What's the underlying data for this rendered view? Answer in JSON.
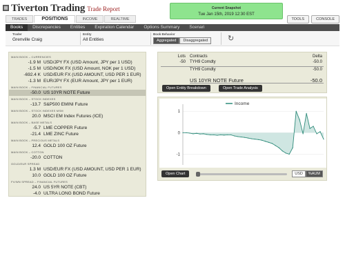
{
  "header": {
    "brand": "Tiverton Trading",
    "subtitle": "Trade Report",
    "snapshot_label": "Current Snapshot",
    "snapshot_time": "Tue Jan 15th, 2019 12:30 EST"
  },
  "top_tabs": [
    "TRADES",
    "POSITIONS",
    "INCOME",
    "REALTIME"
  ],
  "active_top_tab": "POSITIONS",
  "tools": [
    "TOOLS",
    "CONSOLE"
  ],
  "sub_tabs": [
    "Books",
    "Discrepancies",
    "Entities",
    "Expiration Calendar",
    "Options Summary",
    "Scenari"
  ],
  "active_sub_tab": "Books",
  "filters": {
    "trader_label": "Trader",
    "trader_value": "Grenville Craig",
    "entity_label": "Entity",
    "entity_value": "All Entities",
    "behavior_label": "Book Behavior",
    "aggregated": "Aggregated",
    "disaggregated": "Disaggregated",
    "active_behavior": "Aggregated",
    "refresh_icon": "refresh-icon"
  },
  "books": [
    {
      "group": "MAIN BOOK – CURRENCIES",
      "rows": [
        {
          "value": "-1.9 M",
          "name": "USD/JPY FX (USD Amount, JPY per 1 USD)"
        },
        {
          "value": "-1.5 M",
          "name": "USD/NOK FX (USD Amount, NOK per 1 USD)"
        },
        {
          "value": "-692.4 K",
          "name": "USD/EUR FX (USD AMOUNT, USD PER 1 EUR)"
        },
        {
          "value": "-1.3 M",
          "name": "EUR/JPY FX (EUR Amount, JPY per 1 EUR)"
        }
      ]
    },
    {
      "group": "MAIN BOOK – FINANCIAL FUTURES",
      "rows": [
        {
          "value": "-50.0",
          "name": "US 10YR NOTE Future",
          "selected": true
        }
      ]
    },
    {
      "group": "MAIN BOOK – STOCK INDEXES",
      "rows": [
        {
          "value": "-13.7",
          "name": "S&P500 EMINI Future"
        }
      ]
    },
    {
      "group": "MAIN BOOK – STOCK INDEXES MSM",
      "rows": [
        {
          "value": "20.0",
          "name": "MSCI EM Index Futures (ICE)"
        }
      ]
    },
    {
      "group": "MAIN BOOK – BASE METALS",
      "rows": [
        {
          "value": "-5.7",
          "name": "LME COPPER Future"
        },
        {
          "value": "-21.4",
          "name": "LME ZINC Future"
        }
      ]
    },
    {
      "group": "MAIN BOOK – PRECIOUS METALS",
      "rows": [
        {
          "value": "12.4",
          "name": "GOLD 100 OZ Future"
        }
      ]
    },
    {
      "group": "MAIN BOOK – COTTON",
      "rows": [
        {
          "value": "-20.0",
          "name": "COTTON"
        }
      ]
    },
    {
      "group": "GOLD/EUR SPREAD",
      "rows": [
        {
          "value": "1.3 M",
          "name": "USD/EUR FX (USD AMOUNT, USD PER 1 EUR)"
        },
        {
          "value": "10.0",
          "name": "GOLD 100 OZ Future"
        }
      ]
    },
    {
      "group": "FV/WN SPREAD – FINANCIAL FUTURES",
      "rows": [
        {
          "value": "24.0",
          "name": "US 5YR NOTE (CBT)"
        },
        {
          "value": "-4.0",
          "name": "ULTRA LONG BOND Future"
        }
      ]
    }
  ],
  "contracts": {
    "headers": {
      "lots": "Lots",
      "contracts": "Contracts",
      "delta": "Delta"
    },
    "rows": [
      {
        "lots": "-50",
        "contract": "TYH9 Comdty",
        "delta": "-50.0"
      },
      {
        "lots": "",
        "contract": "TYH9 Comdty",
        "delta": "-50.0"
      }
    ],
    "total_name": "US 10YR NOTE Future",
    "total_delta": "-50.0",
    "btn_breakdown": "Open Entity Breakdown",
    "btn_analysis": "Open Trade Analysis"
  },
  "chart_panel": {
    "open_chart": "Open Chart",
    "currencies": [
      "USD",
      "%AUM"
    ],
    "active_currency": "%AUM"
  },
  "chart_data": {
    "type": "area",
    "legend": [
      "Income"
    ],
    "legend_position": "top-center",
    "ylim": [
      -1.5,
      1.2
    ],
    "yticks": [
      1,
      0,
      -1
    ],
    "colors": {
      "line": "#2e8b7a",
      "fill": "#cfe6e2"
    },
    "series": [
      {
        "name": "Income",
        "values": [
          0,
          0,
          -0.02,
          -0.05,
          -0.03,
          -0.06,
          -0.05,
          -0.08,
          -0.1,
          -0.1,
          -0.12,
          -0.1,
          -0.11,
          -0.1,
          -0.1,
          -0.15,
          -0.18,
          -0.2,
          -0.22,
          -0.25,
          -0.28,
          -0.3,
          -0.32,
          -0.35,
          -0.4,
          -0.45,
          -0.5,
          -0.6,
          -0.7,
          -0.85,
          -0.95,
          -1.0,
          -0.7,
          1.0,
          0.6,
          -0.05,
          0.9,
          0.2,
          0.3,
          -0.05,
          0.05,
          -0.3
        ]
      }
    ]
  }
}
